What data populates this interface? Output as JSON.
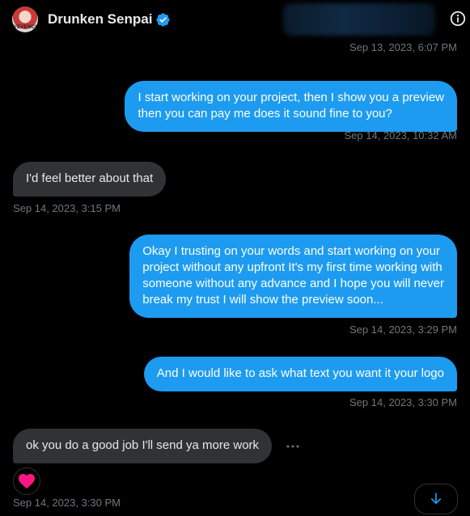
{
  "header": {
    "avatar_text": "VEVENCI",
    "name": "Drunken Senpai",
    "verified_icon": "verified-badge-icon",
    "info_icon": "info-icon"
  },
  "colors": {
    "background": "#000000",
    "outgoing_bubble": "#1d9bf0",
    "incoming_bubble": "#2f3336",
    "timestamp": "#71767b",
    "heart": "#f91880"
  },
  "messages": [
    {
      "type": "timestamp",
      "align": "right",
      "text": "Sep 13, 2023, 6:07 PM"
    },
    {
      "type": "message",
      "direction": "outgoing",
      "lines": [
        "I start working on your project, then I show you a preview",
        "then you can pay me does it sound fine to you?"
      ]
    },
    {
      "type": "timestamp",
      "align": "right",
      "text": "Sep 14, 2023, 10:32 AM"
    },
    {
      "type": "message",
      "direction": "incoming",
      "lines": [
        "I'd feel better about that"
      ]
    },
    {
      "type": "timestamp",
      "align": "left",
      "text": "Sep 14, 2023, 3:15 PM"
    },
    {
      "type": "message",
      "direction": "outgoing",
      "lines": [
        "Okay I trusting on your words and start working on your",
        "project without any upfront It's my first time working with",
        "someone without any advance and I hope you will never",
        "break my trust I will show the preview soon..."
      ]
    },
    {
      "type": "timestamp",
      "align": "right",
      "text": "Sep 14, 2023, 3:29 PM"
    },
    {
      "type": "message",
      "direction": "outgoing",
      "lines": [
        "And I would like to ask what text you want it your logo"
      ]
    },
    {
      "type": "timestamp",
      "align": "right",
      "text": "Sep 14, 2023, 3:30 PM"
    },
    {
      "type": "message",
      "direction": "incoming",
      "lines": [
        "ok you do a good job I'll send ya more work"
      ],
      "reaction": "heart-icon"
    },
    {
      "type": "timestamp",
      "align": "left",
      "text": "Sep 14, 2023, 3:30 PM"
    }
  ],
  "controls": {
    "more_icon": "more-horizontal-icon",
    "scroll_down_icon": "arrow-down-icon"
  }
}
